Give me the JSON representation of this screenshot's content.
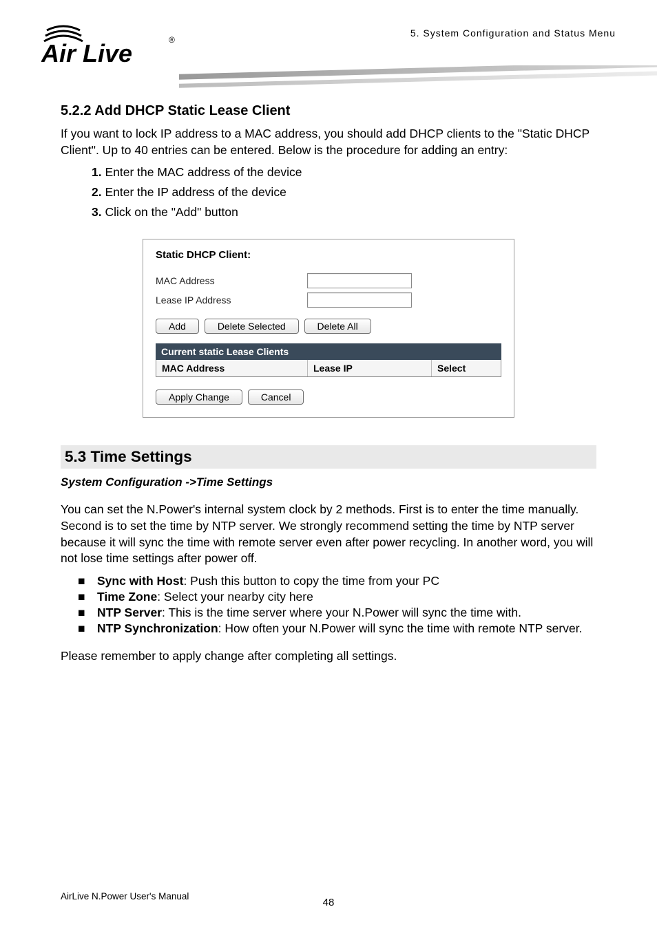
{
  "header": {
    "breadcrumb": "5.  System  Configuration  and  Status  Menu",
    "logo_text_main": "Air Live",
    "logo_reg": "®"
  },
  "section522": {
    "heading": "5.2.2   Add DHCP Static Lease Client",
    "intro": "If you want to lock IP address to a MAC address, you should add DHCP clients to the \"Static DHCP Client\".    Up to 40 entries can be entered.    Below is the procedure for adding an entry:",
    "steps": {
      "s1_num": "1.",
      "s1": "Enter the MAC address of the device",
      "s2_num": "2.",
      "s2": "Enter the IP address of the device",
      "s3_num": "3.",
      "s3": "Click on the \"Add\" button"
    }
  },
  "screenshot": {
    "title": "Static DHCP Client:",
    "label_mac": "MAC Address",
    "label_lease": "Lease IP Address",
    "btn_add": "Add",
    "btn_del_sel": "Delete Selected",
    "btn_del_all": "Delete All",
    "table_header": "Current static Lease Clients",
    "col_mac": "MAC Address",
    "col_lease": "Lease IP",
    "col_select": "Select",
    "btn_apply": "Apply Change",
    "btn_cancel": "Cancel"
  },
  "section53": {
    "heading": "5.3 Time  Settings",
    "subpath": "System Configuration ->Time Settings",
    "para": "You can set the N.Power's internal system clock by 2 methods.    First is to enter the time manually.    Second is to set the time by NTP server.    We strongly recommend setting the time by NTP server because it will sync the time with remote server even after power recycling.    In another word, you will not lose time settings after power off.",
    "b1_bold": "Sync with Host",
    "b1_text": ":    Push this button to copy the time from your PC",
    "b2_bold": "Time Zone",
    "b2_text": ":    Select your nearby city here",
    "b3_bold": "NTP Server",
    "b3_text": ":    This is the time server where your N.Power will sync the time with.",
    "b4_bold": "NTP Synchronization",
    "b4_text": ":    How often your N.Power will sync the time with remote NTP server.",
    "closing": "Please remember to apply change after completing all settings."
  },
  "footer": {
    "text": "AirLive N.Power User's Manual",
    "page": "48"
  }
}
